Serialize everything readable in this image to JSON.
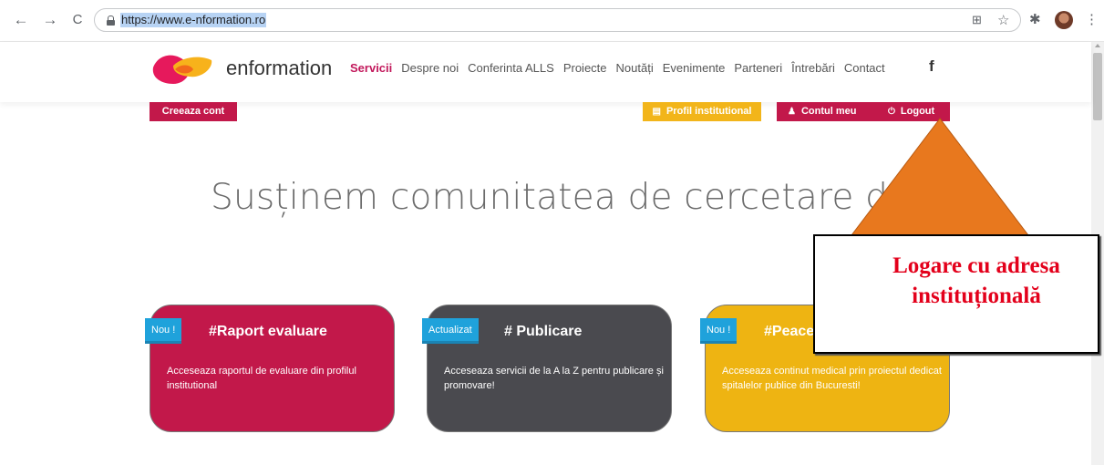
{
  "browser": {
    "url": "https://www.e-nformation.ro",
    "back_glyph": "←",
    "forward_glyph": "→",
    "reload_glyph": "C",
    "menu_glyph": "⋮",
    "star_glyph": "☆",
    "extensions_glyph": "✱",
    "qr_glyph": "⊞"
  },
  "site": {
    "brand": "enformation",
    "menu": [
      "Servicii",
      "Despre noi",
      "Conferinta ALLS",
      "Proiecte",
      "Noutăți",
      "Evenimente",
      "Parteneri",
      "Întrebări",
      "Contact"
    ],
    "active_menu": "Servicii",
    "facebook": "f",
    "colors": {
      "accent": "#c2184a",
      "yellow": "#eeb412",
      "badge": "#1fa2db",
      "grey_card": "#4a4a4f"
    }
  },
  "actions": {
    "create_account": "Creeaza cont",
    "profile": "Profil institutional",
    "account": "Contul meu",
    "logout": "Logout"
  },
  "hero": {
    "title": "Susținem comunitatea de cercetare din România"
  },
  "cards": [
    {
      "badge": "Nou !",
      "title": "#Raport evaluare",
      "text": "Acceseaza raportul de evaluare din profilul institutional"
    },
    {
      "badge": "Actualizat",
      "title": "# Publicare",
      "text": "Acceseaza servicii de la A la Z pentru publicare și promovare!"
    },
    {
      "badge": "Nou !",
      "title": "#Peacemed",
      "text": "Acceseaza continut medical prin proiectul dedicat spitalelor publice din Bucuresti!"
    }
  ],
  "annotation": {
    "line1": "Logare cu adresa",
    "line2": "instituțională",
    "arrow_color": "#e8781e",
    "text_color": "#e3001b"
  }
}
